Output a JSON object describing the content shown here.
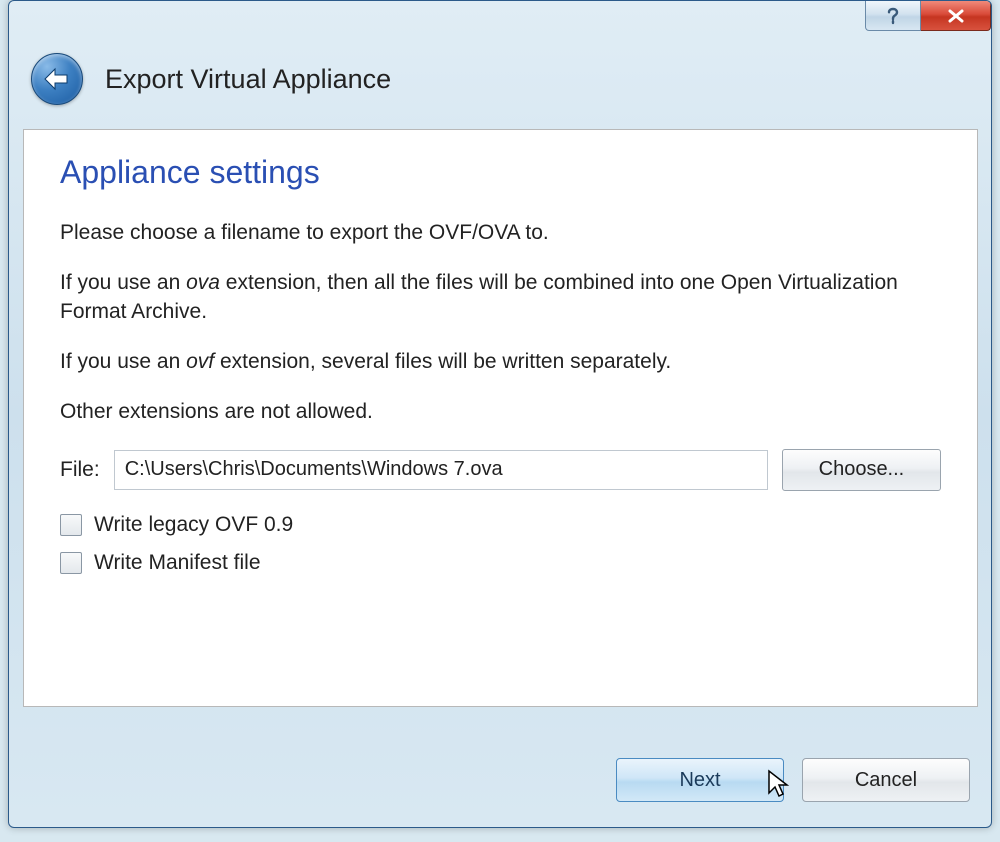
{
  "window": {
    "wizard_title": "Export Virtual Appliance"
  },
  "content": {
    "heading": "Appliance settings",
    "instr1": "Please choose a filename to export the OVF/OVA to.",
    "instr2_pre": "If you use an ",
    "instr2_em": "ova",
    "instr2_post": " extension, then all the files will be combined into one Open Virtualization Format Archive.",
    "instr3_pre": "If you use an ",
    "instr3_em": "ovf",
    "instr3_post": " extension, several files will be written separately.",
    "instr4": "Other extensions are not allowed.",
    "file_label": "File:",
    "file_value": "C:\\Users\\Chris\\Documents\\Windows 7.ova",
    "choose_label": "Choose...",
    "check1": "Write legacy OVF 0.9",
    "check2": "Write Manifest file"
  },
  "footer": {
    "next_label": "Next",
    "cancel_label": "Cancel"
  }
}
